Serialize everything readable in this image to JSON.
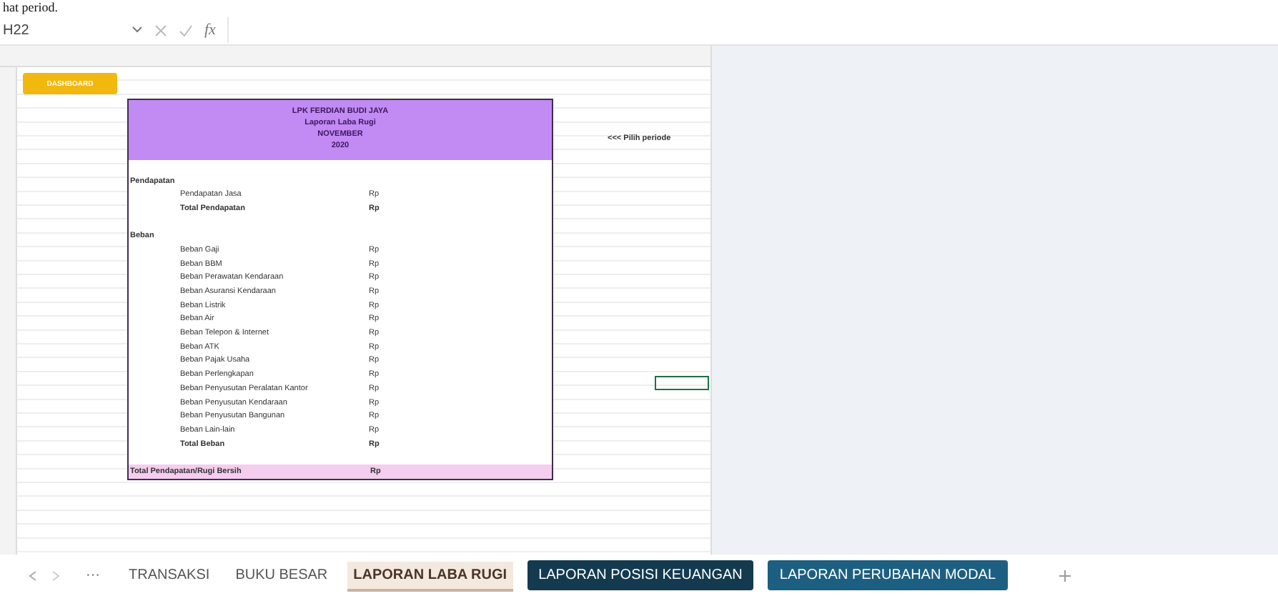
{
  "caption": "hat period.",
  "formula_bar": {
    "name_box": "H22",
    "function_label": "fx"
  },
  "dashboard_button": "DASHBOARD",
  "report": {
    "header": [
      "LPK FERDIAN BUDI JAYA",
      "Laporan Laba Rugi",
      "NOVEMBER",
      "2020"
    ],
    "rows": [
      {
        "kind": "gap"
      },
      {
        "kind": "section",
        "label": "Pendapatan"
      },
      {
        "kind": "item",
        "label": "Pendapatan Jasa",
        "currency": "Rp"
      },
      {
        "kind": "total",
        "label": "Total Pendapatan",
        "currency": "Rp"
      },
      {
        "kind": "gap"
      },
      {
        "kind": "section",
        "label": "Beban"
      },
      {
        "kind": "item",
        "label": "Beban Gaji",
        "currency": "Rp"
      },
      {
        "kind": "item",
        "label": "Beban BBM",
        "currency": "Rp"
      },
      {
        "kind": "item",
        "label": "Beban Perawatan Kendaraan",
        "currency": "Rp"
      },
      {
        "kind": "item",
        "label": "Beban Asuransi Kendaraan",
        "currency": "Rp"
      },
      {
        "kind": "item",
        "label": "Beban Listrik",
        "currency": "Rp"
      },
      {
        "kind": "item",
        "label": "Beban Air",
        "currency": "Rp"
      },
      {
        "kind": "item",
        "label": "Beban Telepon & Internet",
        "currency": "Rp"
      },
      {
        "kind": "item",
        "label": "Beban ATK",
        "currency": "Rp"
      },
      {
        "kind": "item",
        "label": "Beban Pajak Usaha",
        "currency": "Rp"
      },
      {
        "kind": "item",
        "label": "Beban Perlengkapan",
        "currency": "Rp"
      },
      {
        "kind": "item",
        "label": "Beban Penyusutan Peralatan Kantor",
        "currency": "Rp"
      },
      {
        "kind": "item",
        "label": "Beban Penyusutan Kendaraan",
        "currency": "Rp"
      },
      {
        "kind": "item",
        "label": "Beban Penyusutan Bangunan",
        "currency": "Rp"
      },
      {
        "kind": "item",
        "label": "Beban Lain-lain",
        "currency": "Rp"
      },
      {
        "kind": "total",
        "label": "Total Beban",
        "currency": "Rp"
      },
      {
        "kind": "gap"
      },
      {
        "kind": "grand",
        "label": "Total Pendapatan/Rugi Bersih",
        "currency": "Rp"
      }
    ]
  },
  "period_hint": "<<< Pilih periode",
  "sheet_tabs": {
    "more": "···",
    "tabs": [
      {
        "label": "TRANSAKSI",
        "selected": false
      },
      {
        "label": "BUKU BESAR",
        "selected": false
      },
      {
        "label": "LAPORAN LABA RUGI",
        "selected": true
      },
      {
        "label": "LAPORAN POSISI KEUANGAN",
        "selected": false,
        "color": "#133a4f"
      },
      {
        "label": "LAPORAN PERUBAHAN MODAL",
        "selected": false,
        "color": "#1d5f80"
      }
    ]
  }
}
